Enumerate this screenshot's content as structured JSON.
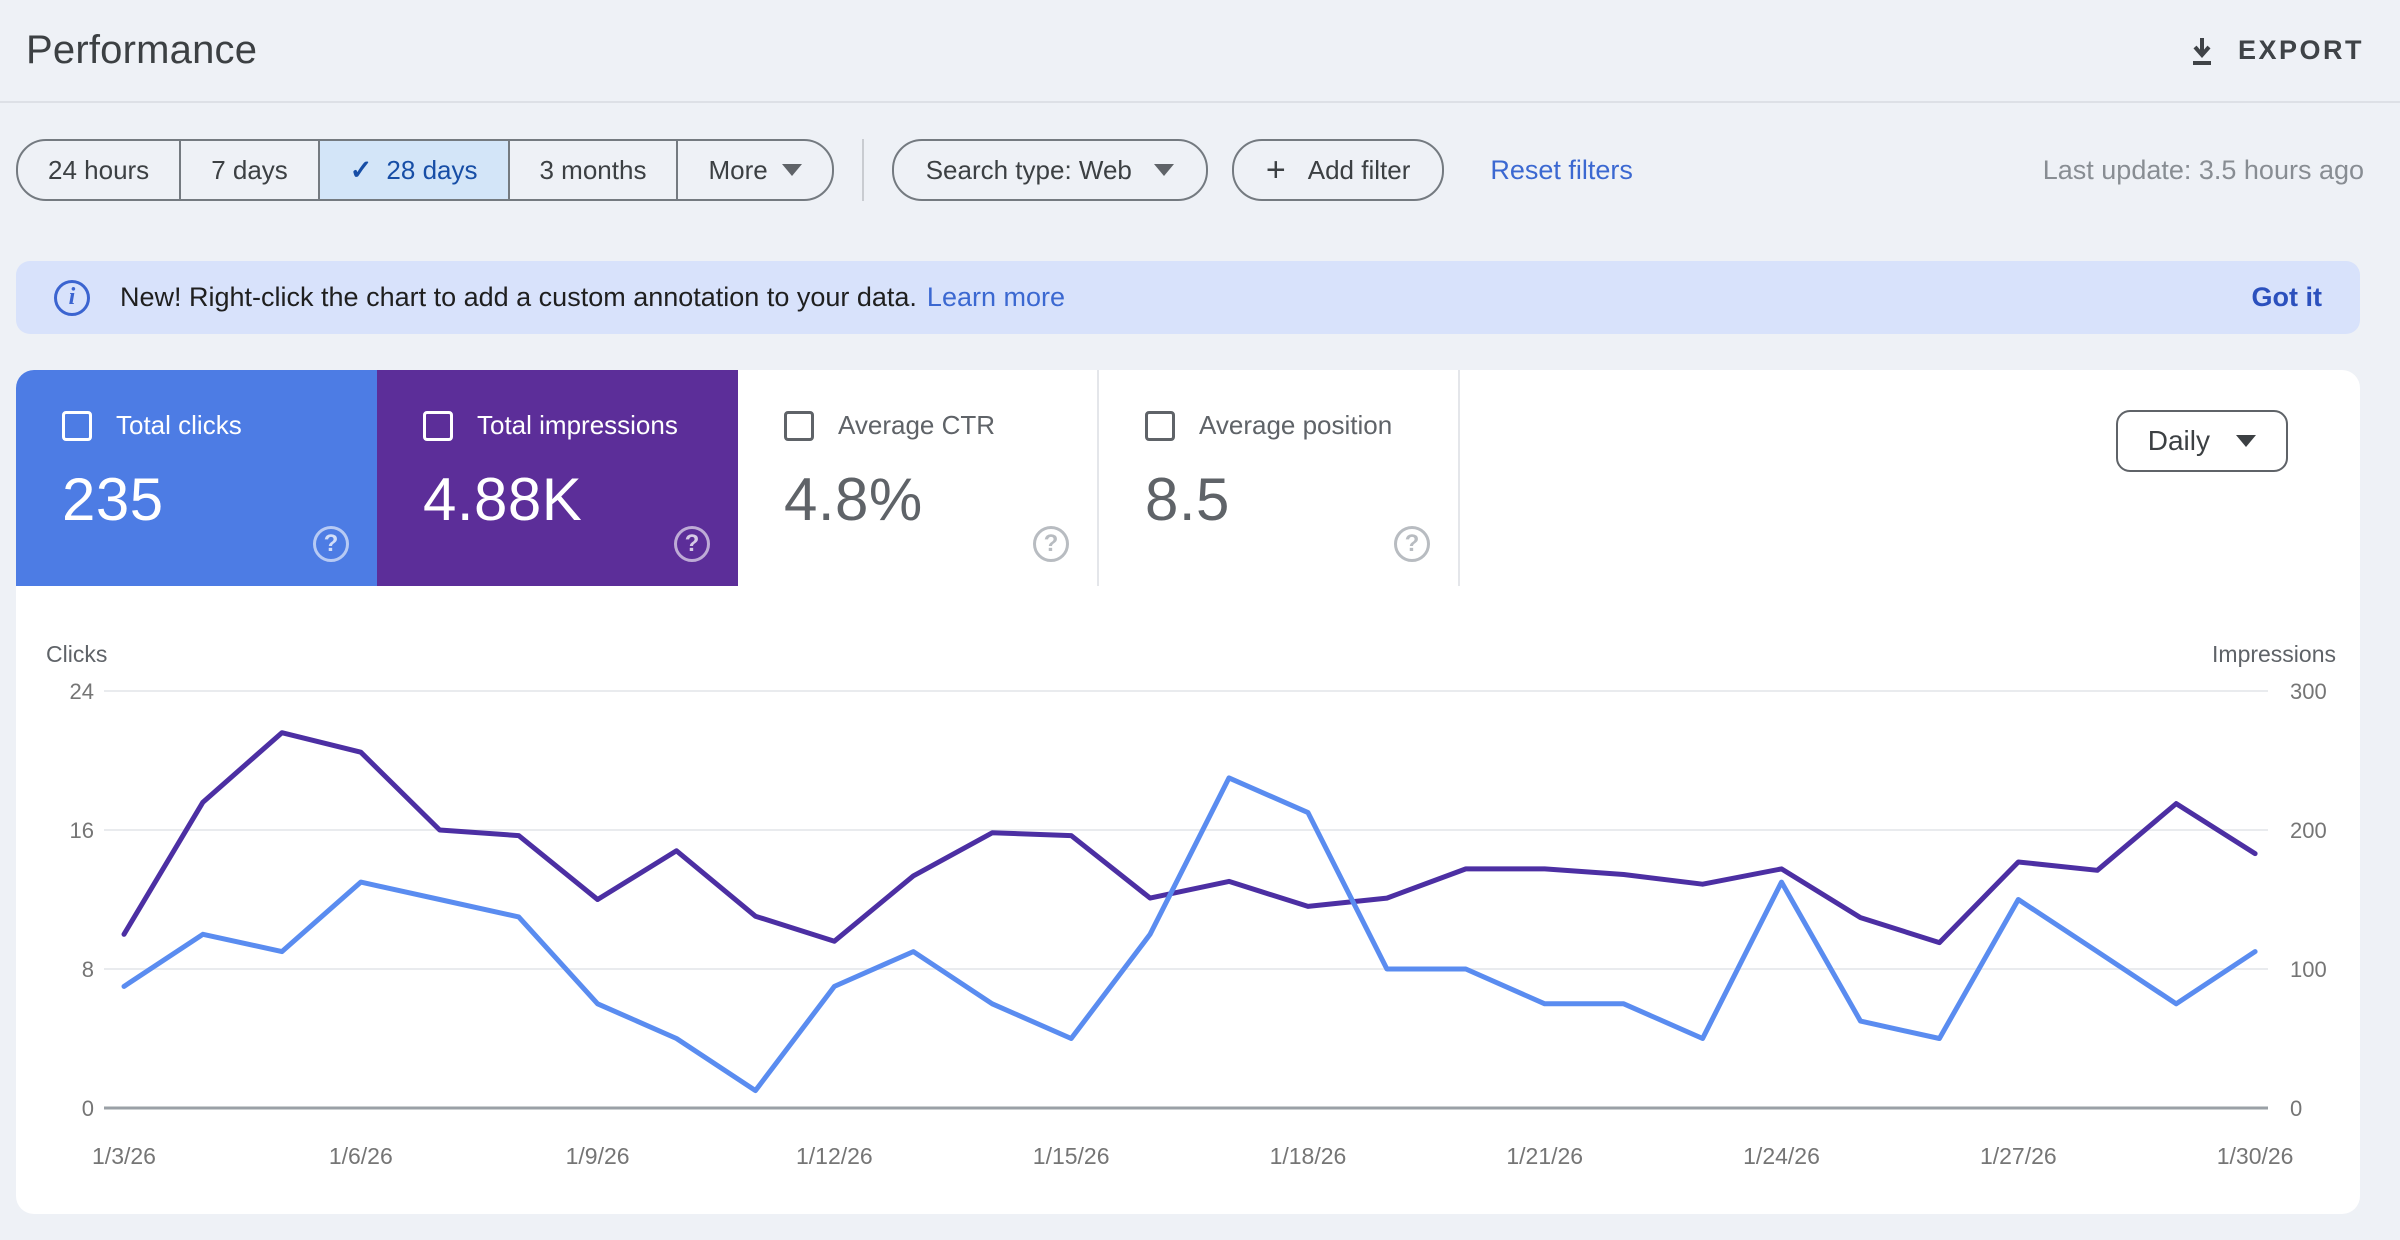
{
  "page": {
    "title": "Performance"
  },
  "header": {
    "export_label": "EXPORT"
  },
  "icons": {
    "check": "✓",
    "plus": "+",
    "info": "i",
    "help": "?",
    "download": "download-arrow-with-tray",
    "caret_down": "filled-triangle-down"
  },
  "filters": {
    "ranges": [
      {
        "label": "24 hours",
        "selected": false
      },
      {
        "label": "7 days",
        "selected": false
      },
      {
        "label": "28 days",
        "selected": true
      },
      {
        "label": "3 months",
        "selected": false
      },
      {
        "label": "More",
        "selected": false,
        "has_caret": true
      }
    ],
    "search_type_label": "Search type: Web",
    "add_filter_label": "Add filter",
    "reset_label": "Reset filters",
    "last_update": "Last update: 3.5 hours ago"
  },
  "banner": {
    "text": "New! Right-click the chart to add a custom annotation to your data.",
    "link_label": "Learn more",
    "dismiss_label": "Got it"
  },
  "metrics": {
    "granularity": "Daily",
    "cards": [
      {
        "label": "Total clicks",
        "value": "235",
        "checked": true,
        "bg": "#4d7ce4"
      },
      {
        "label": "Total impressions",
        "value": "4.88K",
        "checked": true,
        "bg": "#5c2e99"
      },
      {
        "label": "Average CTR",
        "value": "4.8%",
        "checked": false,
        "bg": null
      },
      {
        "label": "Average position",
        "value": "8.5",
        "checked": false,
        "bg": null
      }
    ]
  },
  "chart_data": {
    "type": "line",
    "x": [
      "1/3/26",
      "1/4/26",
      "1/5/26",
      "1/6/26",
      "1/7/26",
      "1/8/26",
      "1/9/26",
      "1/10/26",
      "1/11/26",
      "1/12/26",
      "1/13/26",
      "1/14/26",
      "1/15/26",
      "1/16/26",
      "1/17/26",
      "1/18/26",
      "1/19/26",
      "1/20/26",
      "1/21/26",
      "1/22/26",
      "1/23/26",
      "1/24/26",
      "1/25/26",
      "1/26/26",
      "1/27/26",
      "1/28/26",
      "1/29/26",
      "1/30/26"
    ],
    "x_tick_every": 3,
    "left_axis": {
      "label": "Clicks",
      "ticks": [
        0,
        8,
        16,
        24
      ],
      "max": 24
    },
    "right_axis": {
      "label": "Impressions",
      "ticks": [
        0,
        100,
        200,
        300
      ],
      "max": 300
    },
    "grid": true,
    "series": [
      {
        "name": "Clicks",
        "axis": "left",
        "color": "#5a8cf0",
        "values": [
          7,
          10,
          9,
          13,
          12,
          11,
          6,
          4,
          1,
          7,
          9,
          6,
          4,
          10,
          19,
          17,
          8,
          8,
          6,
          6,
          4,
          13,
          5,
          4,
          12,
          9,
          6,
          9
        ]
      },
      {
        "name": "Impressions",
        "axis": "right",
        "color": "#4c2fa3",
        "values": [
          125,
          220,
          270,
          256,
          200,
          196,
          150,
          185,
          138,
          120,
          167,
          198,
          196,
          151,
          163,
          145,
          151,
          172,
          172,
          168,
          161,
          172,
          137,
          119,
          177,
          171,
          219,
          183
        ]
      }
    ]
  }
}
